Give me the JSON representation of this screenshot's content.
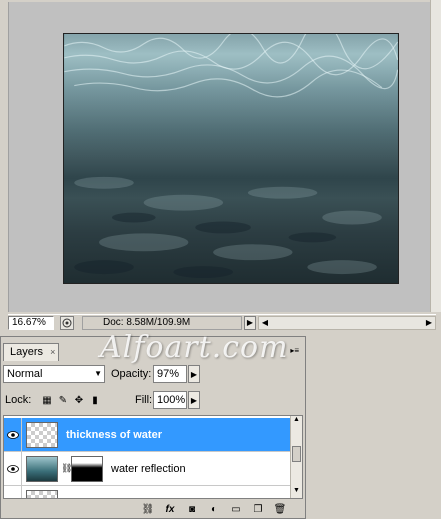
{
  "document": {
    "zoom": "16.67%",
    "doc_info": "Doc: 8.58M/109.9M"
  },
  "layers_panel": {
    "tab_label": "Layers",
    "tab_close": "×",
    "blend_mode": "Normal",
    "opacity_label": "Opacity:",
    "opacity_value": "97%",
    "lock_label": "Lock:",
    "fill_label": "Fill:",
    "fill_value": "100%",
    "layers": [
      {
        "name": "thickness of water",
        "selected": true
      },
      {
        "name": "water reflection",
        "selected": false
      }
    ],
    "bottom_icons": [
      "link-icon",
      "fx-icon",
      "mask-icon",
      "adjustment-icon",
      "folder-icon",
      "new-layer-icon",
      "trash-icon"
    ]
  },
  "watermark": "Alfoart.com",
  "colors": {
    "selected_layer": "#3399ff",
    "panel_bg": "#d4d0c8"
  }
}
